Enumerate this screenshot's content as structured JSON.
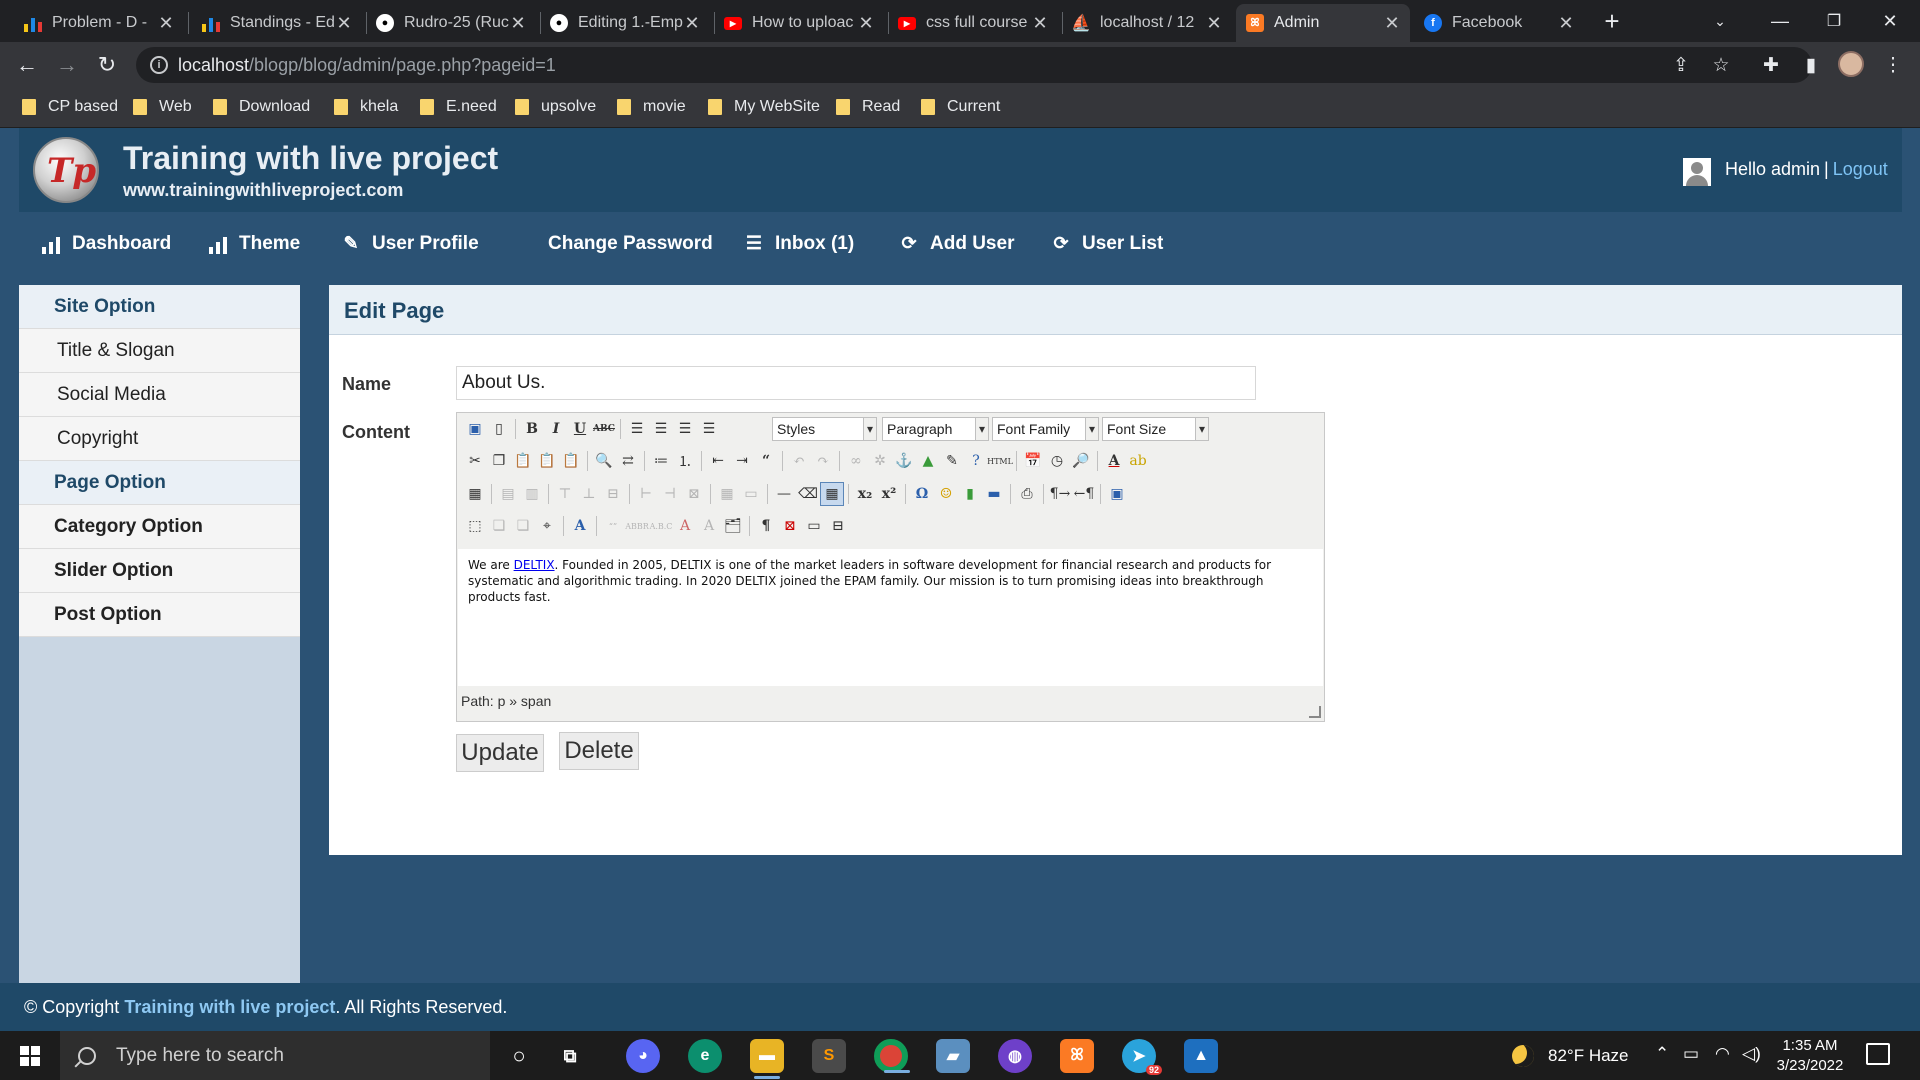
{
  "browser": {
    "tabs": [
      {
        "title": "Problem - D -",
        "favicon": "codeforces-icon",
        "active": false
      },
      {
        "title": "Standings - Ed",
        "favicon": "codeforces-icon",
        "active": false
      },
      {
        "title": "Rudro-25 (Ruc",
        "favicon": "github-icon",
        "active": false
      },
      {
        "title": "Editing 1.-Emp",
        "favicon": "github-icon",
        "active": false
      },
      {
        "title": "How to uploac",
        "favicon": "youtube-icon",
        "active": false
      },
      {
        "title": "css full course",
        "favicon": "youtube-icon",
        "active": false
      },
      {
        "title": "localhost / 12",
        "favicon": "phpmyadmin-icon",
        "active": false
      },
      {
        "title": "Admin",
        "favicon": "xampp-icon",
        "active": true
      },
      {
        "title": "Facebook",
        "favicon": "facebook-icon",
        "active": false
      }
    ],
    "url_host": "localhost",
    "url_path": "/blogp/blog/admin/page.php?pageid=1",
    "bookmarks": [
      "CP based",
      "Web",
      "Download",
      "khela",
      "E.need",
      "upsolve",
      "movie",
      "My WebSite",
      "Read",
      "Current"
    ]
  },
  "site": {
    "title": "Training with live project",
    "url": "www.trainingwithliveproject.com",
    "logo_text": "Tp",
    "hello": "Hello admin",
    "separator": "|",
    "logout": "Logout"
  },
  "nav": [
    {
      "label": "Dashboard",
      "icon": "bar-chart-icon"
    },
    {
      "label": "Theme",
      "icon": "bar-chart-icon"
    },
    {
      "label": "User Profile",
      "icon": "edit-icon"
    },
    {
      "label": "Change Password",
      "icon": ""
    },
    {
      "label": "Inbox (1)",
      "icon": "list-icon"
    },
    {
      "label": "Add User",
      "icon": "refresh-icon"
    },
    {
      "label": "User List",
      "icon": "refresh-icon"
    }
  ],
  "sidebar": [
    {
      "label": "Site Option",
      "type": "head"
    },
    {
      "label": "Title & Slogan",
      "type": "sub"
    },
    {
      "label": "Social Media",
      "type": "sub"
    },
    {
      "label": "Copyright",
      "type": "sub"
    },
    {
      "label": "Page Option",
      "type": "head"
    },
    {
      "label": "Category Option",
      "type": "head"
    },
    {
      "label": "Slider Option",
      "type": "head"
    },
    {
      "label": "Post Option",
      "type": "head"
    }
  ],
  "page": {
    "heading": "Edit Page",
    "name_label": "Name",
    "name_value": "About Us.",
    "content_label": "Content",
    "editor": {
      "styles": "Styles",
      "paragraph": "Paragraph",
      "font_family": "Font Family",
      "font_size": "Font Size",
      "link_text": "DELTIX",
      "body_before": "We are ",
      "body_after": ". Founded in 2005, DELTIX is one of the market leaders in software development for financial research and products for systematic and algorithmic trading. In 2020 DELTIX joined the EPAM family. Our mission is to turn promising ideas into breakthrough products fast.",
      "path": "Path: p » span"
    },
    "update_label": "Update",
    "delete_label": "Delete"
  },
  "footer": {
    "prefix": "© Copyright ",
    "brand": "Training with live project",
    "suffix": ". All Rights Reserved."
  },
  "taskbar": {
    "search_placeholder": "Type here to search",
    "weather": "82°F  Haze",
    "time": "1:35 AM",
    "date": "3/23/2022",
    "telegram_badge": "92"
  }
}
